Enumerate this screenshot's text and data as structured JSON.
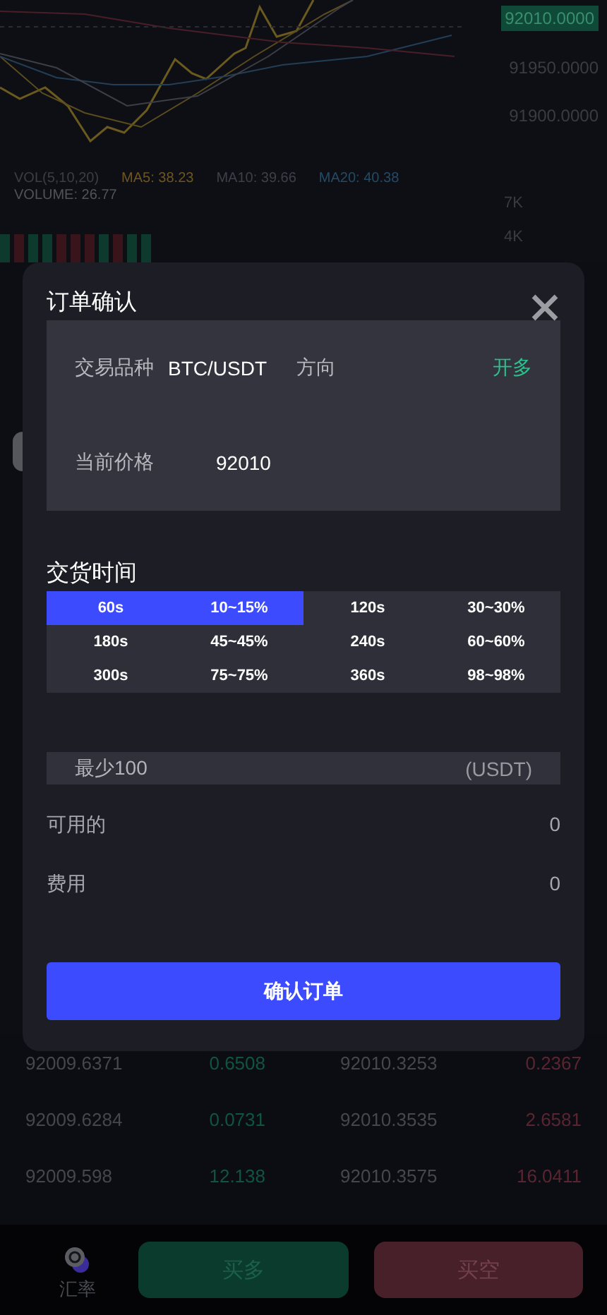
{
  "chart": {
    "price_tag": "92010.0000",
    "price_ticks": [
      "91950.0000",
      "91900.0000"
    ],
    "indicators": [
      {
        "label": "VOL(5,10,20)",
        "color": "#3b3e46"
      },
      {
        "label": "MA5: 38.23",
        "color": "#6e5521"
      },
      {
        "label": "MA10: 39.66",
        "color": "#3e4049"
      },
      {
        "label": "MA20: 40.38",
        "color": "#244a66"
      }
    ],
    "volume_label": "VOLUME: 26.77",
    "volume_ticks": [
      "7K",
      "4K"
    ]
  },
  "order_book": [
    {
      "bid_price": "92009.6371",
      "bid_amount": "0.6508",
      "ask_price": "92010.3253",
      "ask_amount": "0.2367"
    },
    {
      "bid_price": "92009.6284",
      "bid_amount": "0.0731",
      "ask_price": "92010.3535",
      "ask_amount": "2.6581"
    },
    {
      "bid_price": "92009.598",
      "bid_amount": "12.138",
      "ask_price": "92010.3575",
      "ask_amount": "16.0411"
    }
  ],
  "bottom_bar": {
    "rate_label": "汇率",
    "buttons": [
      {
        "label": "买多",
        "kind": "buy"
      },
      {
        "label": "买空",
        "kind": "sell"
      }
    ]
  },
  "dialog": {
    "title": "订单确认",
    "symbol_label": "交易品种",
    "symbol": "BTC/USDT",
    "direction_label": "方向",
    "direction": "开多",
    "price_label": "当前价格",
    "price": "92010",
    "delivery_title": "交货时间",
    "options": [
      {
        "time": "60s",
        "rate": "10~15%",
        "selected": true
      },
      {
        "time": "120s",
        "rate": "30~30%",
        "selected": false
      },
      {
        "time": "180s",
        "rate": "45~45%",
        "selected": false
      },
      {
        "time": "240s",
        "rate": "60~60%",
        "selected": false
      },
      {
        "time": "300s",
        "rate": "75~75%",
        "selected": false
      },
      {
        "time": "360s",
        "rate": "98~98%",
        "selected": false
      }
    ],
    "amount": {
      "placeholder": "最少100",
      "unit": "(USDT)"
    },
    "available_label": "可用的",
    "available": "0",
    "fee_label": "费用",
    "fee": "0",
    "confirm": "确认订单"
  }
}
